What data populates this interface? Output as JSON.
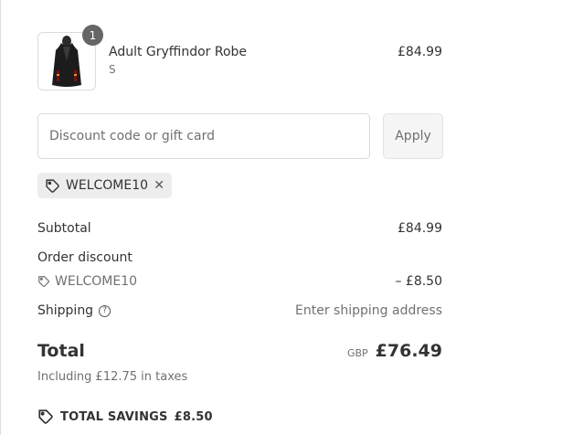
{
  "line_item": {
    "quantity": "1",
    "name": "Adult Gryffindor Robe",
    "variant": "S",
    "price": "£84.99",
    "image_icon": "robe-icon"
  },
  "discount_form": {
    "placeholder": "Discount code or gift card",
    "value": "",
    "apply_label": "Apply"
  },
  "applied_code": {
    "code": "WELCOME10",
    "tag_icon": "tag-icon",
    "remove_icon": "close-icon"
  },
  "summary": {
    "subtotal_label": "Subtotal",
    "subtotal_value": "£84.99",
    "order_discount_label": "Order discount",
    "discount_code": "WELCOME10",
    "discount_value": "– £8.50",
    "shipping_label": "Shipping",
    "shipping_value": "Enter shipping address",
    "total_label": "Total",
    "currency": "GBP",
    "total_value": "£76.49",
    "taxes_note": "Including £12.75 in taxes",
    "savings_label": "TOTAL SAVINGS",
    "savings_value": "£8.50"
  }
}
